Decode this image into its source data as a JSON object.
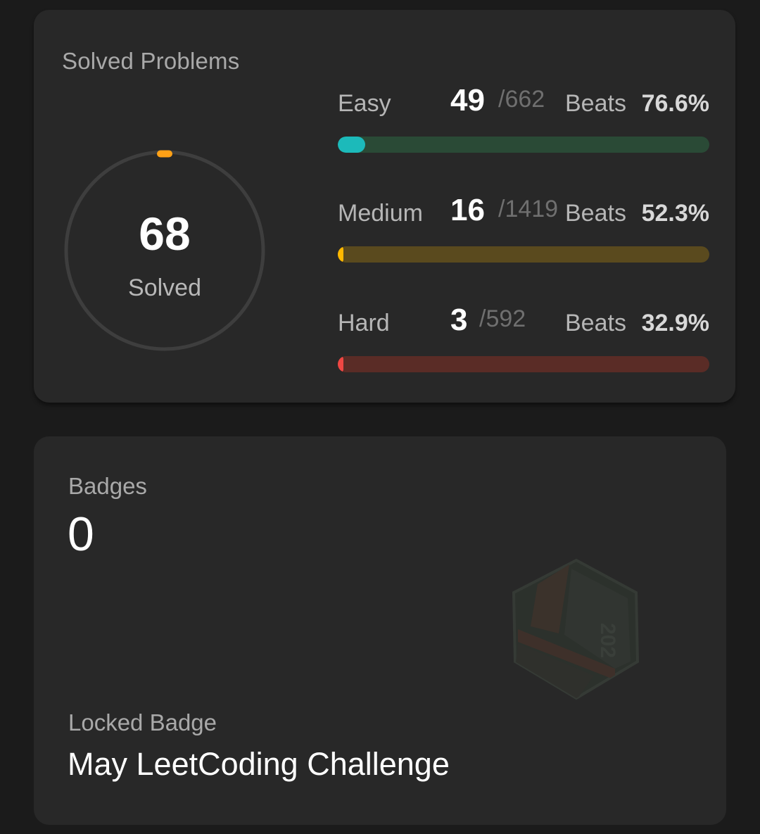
{
  "solved_card": {
    "title": "Solved Problems",
    "ring": {
      "count": "68",
      "label": "Solved",
      "accent_color": "#ffa116",
      "track_color": "#3e3e3e"
    },
    "difficulties": [
      {
        "name": "Easy",
        "solved": "49",
        "total": "/662",
        "beats_label": "Beats",
        "beats_value": "76.6%",
        "progress": 0.074,
        "fill_color": "#1cbaba",
        "track_color": "#2a4a36"
      },
      {
        "name": "Medium",
        "solved": "16",
        "total": "/1419",
        "beats_label": "Beats",
        "beats_value": "52.3%",
        "progress": 0.011,
        "fill_color": "#ffb800",
        "track_color": "#5a4a1e"
      },
      {
        "name": "Hard",
        "solved": "3",
        "total": "/592",
        "beats_label": "Beats",
        "beats_value": "32.9%",
        "progress": 0.005,
        "fill_color": "#ef4743",
        "track_color": "#5a2c26"
      }
    ]
  },
  "badges_card": {
    "label": "Badges",
    "count": "0",
    "locked_label": "Locked Badge",
    "locked_name": "May LeetCoding Challenge",
    "badge_icon": "locked-hexagon-badge-icon"
  }
}
